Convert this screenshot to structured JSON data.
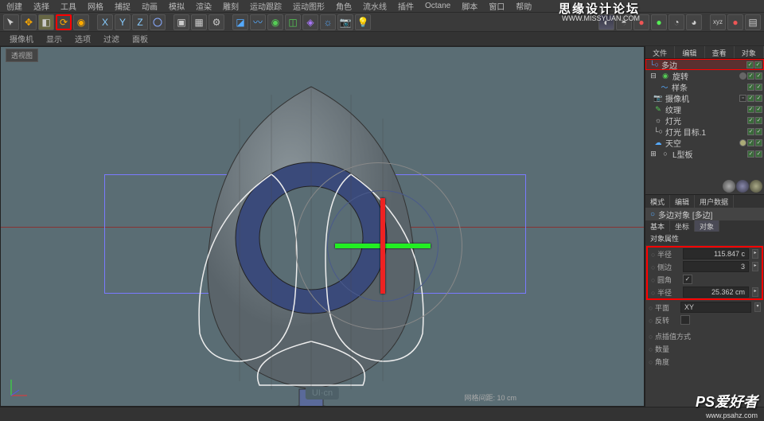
{
  "menu": {
    "items": [
      "创建",
      "选择",
      "工具",
      "网格",
      "捕捉",
      "动画",
      "模拟",
      "渲染",
      "雕刻",
      "运动跟踪",
      "运动图形",
      "角色",
      "流水线",
      "插件",
      "Octane",
      "脚本",
      "窗口",
      "帮助"
    ]
  },
  "status": {
    "s1": "摄像机",
    "s2": "显示",
    "s3": "选项",
    "s4": "过滤",
    "s5": "面板"
  },
  "rtab": {
    "t1": "文件",
    "t2": "编辑",
    "t3": "查看",
    "t4": "对象"
  },
  "tree": {
    "r0": {
      "label": "多边"
    },
    "r1": {
      "label": "旋转"
    },
    "r2": {
      "label": "样条"
    },
    "r3": {
      "label": "摄像机"
    },
    "r4": {
      "label": "纹理"
    },
    "r5": {
      "label": "灯光"
    },
    "r6": {
      "label": "灯光 目标.1"
    },
    "r7": {
      "label": "天空"
    },
    "r8": {
      "label": "L型板"
    }
  },
  "ptab": {
    "t1": "模式",
    "t2": "编辑",
    "t3": "用户数据"
  },
  "obj": {
    "title": "多边对象 [多边]"
  },
  "psub": {
    "t1": "基本",
    "t2": "坐标",
    "t3": "对象"
  },
  "phead": {
    "label": "对象属性"
  },
  "props": {
    "radius": {
      "label": "半径",
      "value": "115.847 c"
    },
    "sides": {
      "label": "侧边",
      "value": "3"
    },
    "round": {
      "label": "圆角",
      "checked": true
    },
    "radius2": {
      "label": "半径",
      "value": "25.362 cm"
    },
    "plane": {
      "label": "平面",
      "value": "XY"
    },
    "reverse": {
      "label": "反转"
    },
    "ptmode": {
      "label": "点插值方式"
    },
    "count": {
      "label": "数量"
    },
    "angle": {
      "label": "角度"
    }
  },
  "vp": {
    "tab": "透视图",
    "grid": "网格间距: 10 cm",
    "logo": "UI·cn"
  },
  "wm": {
    "tl": "思缘设计论坛",
    "url2": "WWW.MISSYUAN.COM",
    "ps": "PS爱好者",
    "url": "www.psahz.com"
  }
}
